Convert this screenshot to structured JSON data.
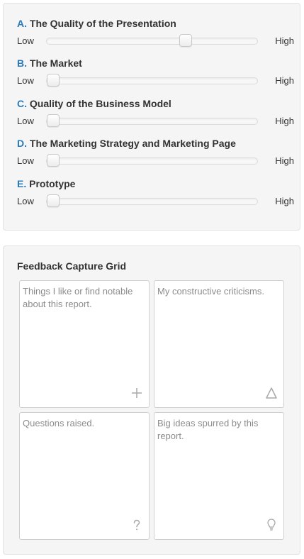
{
  "criteria": [
    {
      "letter": "A.",
      "title": "The Quality of the Presentation",
      "value": 0.67
    },
    {
      "letter": "B.",
      "title": "The Market",
      "value": 0.0
    },
    {
      "letter": "C.",
      "title": "Quality of the Business Model",
      "value": 0.0
    },
    {
      "letter": "D.",
      "title": "The Marketing Strategy and Marketing Page",
      "value": 0.0
    },
    {
      "letter": "E.",
      "title": "Prototype",
      "value": 0.0
    }
  ],
  "scale": {
    "low": "Low",
    "high": "High"
  },
  "feedback": {
    "title": "Feedback Capture Grid",
    "cells": [
      {
        "placeholder": "Things I like or find notable about this report.",
        "icon": "plus-icon"
      },
      {
        "placeholder": "My constructive criticisms.",
        "icon": "delta-icon"
      },
      {
        "placeholder": "Questions raised.",
        "icon": "question-icon"
      },
      {
        "placeholder": "Big ideas spurred by this report.",
        "icon": "lightbulb-icon"
      }
    ]
  },
  "colors": {
    "accent_letter": "#2a7ab8",
    "panel_bg": "#f5f5f5",
    "placeholder_text": "#8c8c8c"
  }
}
